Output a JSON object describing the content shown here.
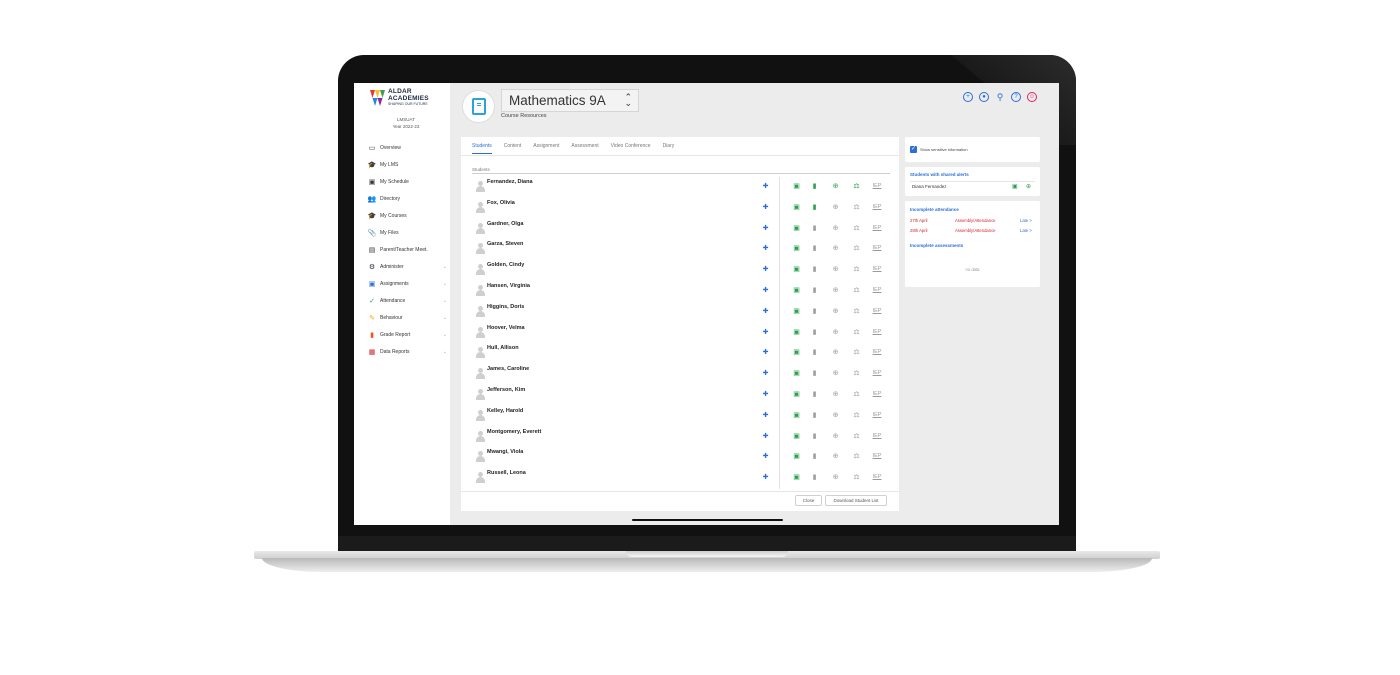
{
  "app": {
    "logo": {
      "line1": "ALDAR",
      "line2": "ACADEMIES",
      "tagline": "SHAPING OUR FUTURE"
    },
    "user": {
      "name": "LMSUAT",
      "year": "Year 2022-23"
    }
  },
  "sidebar": {
    "items": [
      {
        "label": "Overview",
        "icon": "overview-icon",
        "expandable": false
      },
      {
        "label": "My LMS",
        "icon": "mortarboard-icon",
        "expandable": false
      },
      {
        "label": "My Schedule",
        "icon": "calendar-icon",
        "expandable": false
      },
      {
        "label": "Directory",
        "icon": "people-icon",
        "expandable": false
      },
      {
        "label": "My Courses",
        "icon": "mortarboard-icon",
        "expandable": false
      },
      {
        "label": "My Files",
        "icon": "paperclip-icon",
        "expandable": false
      },
      {
        "label": "Parent/Teacher Meet.",
        "icon": "meeting-icon",
        "expandable": false
      },
      {
        "label": "Administer",
        "icon": "gear-icon",
        "expandable": true
      },
      {
        "label": "Assignments",
        "icon": "assignment-icon",
        "expandable": true
      },
      {
        "label": "Attendance",
        "icon": "attendance-icon",
        "expandable": true
      },
      {
        "label": "Behaviour",
        "icon": "behaviour-icon",
        "expandable": true
      },
      {
        "label": "Grade Report",
        "icon": "bookmark-icon",
        "expandable": true
      },
      {
        "label": "Data Reports",
        "icon": "chart-icon",
        "expandable": true
      }
    ]
  },
  "header": {
    "course_title": "Mathematics 9A",
    "course_subtitle": "Course Resources",
    "top_icons": [
      "add-icon",
      "eye-icon",
      "search-icon",
      "help-icon",
      "user-icon"
    ]
  },
  "tabs": [
    "Students",
    "Content",
    "Assignment",
    "Assessment",
    "Video Conference",
    "Diary"
  ],
  "active_tab": "Students",
  "students": {
    "section_label": "Students",
    "list": [
      {
        "name": "Fernandez, Diana",
        "notes": true,
        "medical": true
      },
      {
        "name": "Fox, Olivia",
        "notes": true,
        "medical": false
      },
      {
        "name": "Gardner, Olga",
        "notes": false,
        "medical": false
      },
      {
        "name": "Garza, Steven",
        "notes": false,
        "medical": false
      },
      {
        "name": "Golden, Cindy",
        "notes": false,
        "medical": false
      },
      {
        "name": "Hansen, Virginia",
        "notes": false,
        "medical": false
      },
      {
        "name": "Higgins, Doris",
        "notes": false,
        "medical": false
      },
      {
        "name": "Hoover, Velma",
        "notes": false,
        "medical": false
      },
      {
        "name": "Hull, Allison",
        "notes": false,
        "medical": false
      },
      {
        "name": "James, Caroline",
        "notes": false,
        "medical": false
      },
      {
        "name": "Jefferson, Kim",
        "notes": false,
        "medical": false
      },
      {
        "name": "Kelley, Harold",
        "notes": false,
        "medical": false
      },
      {
        "name": "Montgomery, Everett",
        "notes": false,
        "medical": false
      },
      {
        "name": "Mwangi, Viola",
        "notes": false,
        "medical": false
      },
      {
        "name": "Russell, Leona",
        "notes": false,
        "medical": false
      }
    ],
    "iep_label": "IEP"
  },
  "footer": {
    "close_label": "Close",
    "download_label": "Download Student List"
  },
  "widgets": {
    "sensitive": {
      "label": "Show sensitive information",
      "checked": true
    },
    "shared_alerts": {
      "title": "Students with shared alerts",
      "student": "Diana Fernandez"
    },
    "incomplete_attendance": {
      "title": "Incomplete attendance",
      "rows": [
        {
          "date": "27th April",
          "type": "Assembly/Attendance",
          "action": "Late >"
        },
        {
          "date": "28th April",
          "type": "Assembly/Attendance",
          "action": "Late >"
        }
      ]
    },
    "incomplete_assessments": {
      "title": "Incomplete assessments",
      "empty": "no data"
    }
  },
  "colors": {
    "accent": "#2a6fd6",
    "success": "#2ba24c",
    "danger": "#d61f2f",
    "muted": "#9e9e9e"
  }
}
